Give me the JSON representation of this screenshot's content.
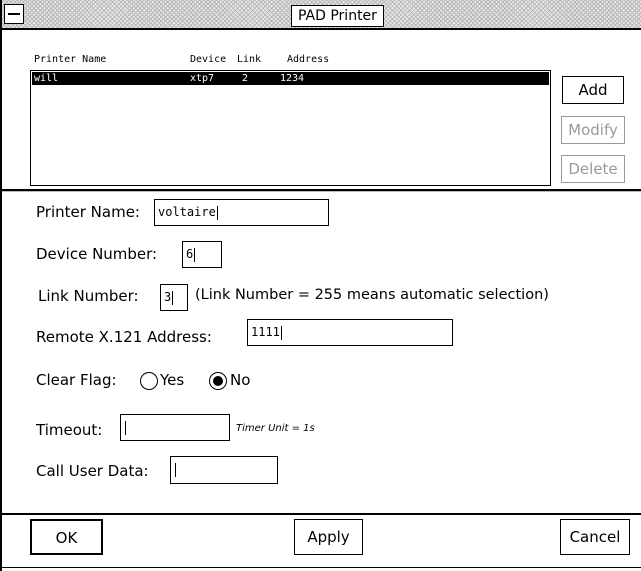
{
  "window": {
    "title": "PAD Printer"
  },
  "printer_list": {
    "columns": [
      "Printer Name",
      "Device",
      "Link",
      "Address"
    ],
    "rows": [
      {
        "name": "will",
        "device": "xtp7",
        "link": "2",
        "address": "1234"
      }
    ]
  },
  "list_buttons": {
    "add": "Add",
    "modify": "Modify",
    "delete": "Delete"
  },
  "form": {
    "printer_name_label": "Printer Name:",
    "printer_name_value": "voltaire",
    "device_number_label": "Device Number:",
    "device_number_value": "6",
    "link_number_label": "Link Number:",
    "link_number_value": "3",
    "link_number_hint": "(Link Number = 255 means automatic selection)",
    "remote_address_label": "Remote X.121 Address:",
    "remote_address_value": "1111",
    "clear_flag_label": "Clear Flag:",
    "clear_flag_options": [
      "Yes",
      "No"
    ],
    "clear_flag_selected": "No",
    "timeout_label": "Timeout:",
    "timeout_value": "",
    "timeout_hint": "Timer Unit = 1s",
    "call_user_data_label": "Call User Data:",
    "call_user_data_value": ""
  },
  "footer": {
    "ok": "OK",
    "apply": "Apply",
    "cancel": "Cancel"
  },
  "icons": {
    "window_menu": "window-menu-icon"
  }
}
